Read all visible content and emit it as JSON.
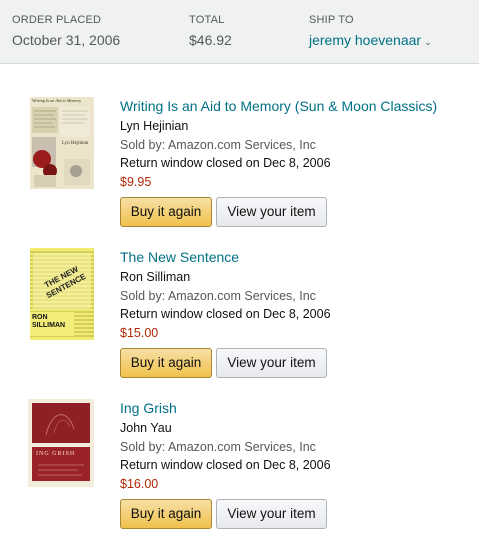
{
  "header": {
    "order_placed_label": "ORDER PLACED",
    "order_placed_value": "October 31, 2006",
    "total_label": "TOTAL",
    "total_value": "$46.92",
    "ship_to_label": "SHIP TO",
    "ship_to_value": "jeremy hoevenaar"
  },
  "items": [
    {
      "title": "Writing Is an Aid to Memory (Sun & Moon Classics)",
      "author": "Lyn Hejinian",
      "seller": "Sold by: Amazon.com Services, Inc",
      "return_window": "Return window closed on Dec 8, 2006",
      "price": "$9.95",
      "buy_again_label": "Buy it again",
      "view_item_label": "View your item",
      "cover_text_top": "Writing Is an Aid to Memory",
      "cover_text_author": "Lyn Hejinian"
    },
    {
      "title": "The New Sentence",
      "author": "Ron Silliman",
      "seller": "Sold by: Amazon.com Services, Inc",
      "return_window": "Return window closed on Dec 8, 2006",
      "price": "$15.00",
      "buy_again_label": "Buy it again",
      "view_item_label": "View your item",
      "cover_text_title": "THE NEW SENTENCE",
      "cover_text_author": "RON SILLIMAN"
    },
    {
      "title": "Ing Grish",
      "author": "John Yau",
      "seller": "Sold by: Amazon.com Services, Inc",
      "return_window": "Return window closed on Dec 8, 2006",
      "price": "$16.00",
      "buy_again_label": "Buy it again",
      "view_item_label": "View your item",
      "cover_text_title": "ING GRISH"
    }
  ],
  "colors": {
    "link": "#007185",
    "price": "#b12704",
    "buy_button": "#f0c14b"
  }
}
